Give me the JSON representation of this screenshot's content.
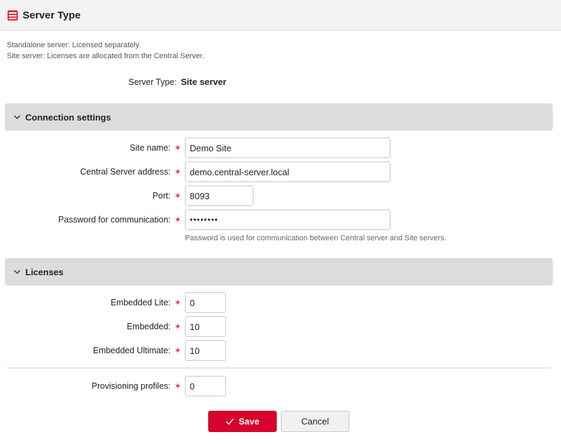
{
  "header": {
    "title": "Server Type",
    "icon": "server-icon",
    "icon_color": "#e0303a"
  },
  "description": {
    "line1": "Standalone server: Licensed separately.",
    "line2": "Site server: Licenses are allocated from the Central Server."
  },
  "server_type": {
    "label": "Server Type:",
    "value": "Site server"
  },
  "connection": {
    "title": "Connection settings",
    "site_name": {
      "label": "Site name:",
      "value": "Demo Site"
    },
    "central_address": {
      "label": "Central Server address:",
      "value": "demo.central-server.local"
    },
    "port": {
      "label": "Port:",
      "value": "8093"
    },
    "password": {
      "label": "Password for communication:",
      "value": "••••••••",
      "hint": "Password is used for communication between Central server and Site servers."
    }
  },
  "licenses": {
    "title": "Licenses",
    "embedded_lite": {
      "label": "Embedded Lite:",
      "value": "0"
    },
    "embedded": {
      "label": "Embedded:",
      "value": "10"
    },
    "embedded_ultimate": {
      "label": "Embedded Ultimate:",
      "value": "10"
    },
    "provisioning": {
      "label": "Provisioning profiles:",
      "value": "0"
    }
  },
  "required_marker": "✶",
  "actions": {
    "save_label": "Save",
    "cancel_label": "Cancel",
    "save_color": "#d8002c"
  }
}
